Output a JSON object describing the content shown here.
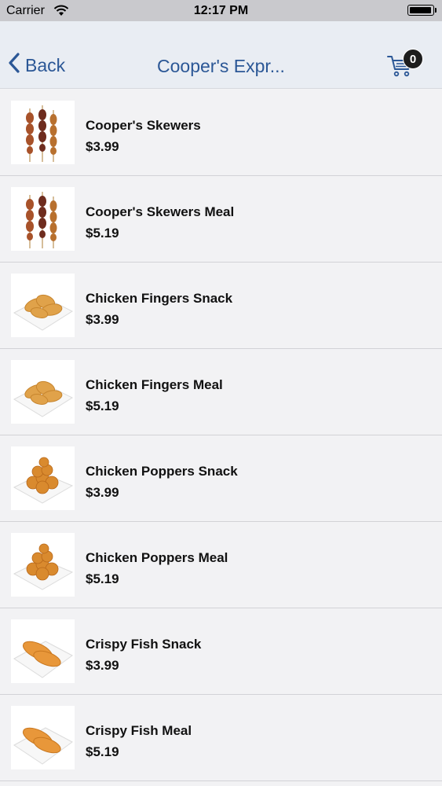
{
  "status_bar": {
    "carrier": "Carrier",
    "time": "12:17 PM"
  },
  "nav": {
    "back_label": "Back",
    "title": "Cooper's Expr...",
    "cart_count": "0"
  },
  "items": [
    {
      "name": "Cooper's Skewers",
      "price": "$3.99",
      "image": "skewers-image"
    },
    {
      "name": "Cooper's Skewers Meal",
      "price": "$5.19",
      "image": "skewers-image"
    },
    {
      "name": "Chicken Fingers Snack",
      "price": "$3.99",
      "image": "chicken-fingers-image"
    },
    {
      "name": "Chicken Fingers Meal",
      "price": "$5.19",
      "image": "chicken-fingers-image"
    },
    {
      "name": "Chicken Poppers Snack",
      "price": "$3.99",
      "image": "chicken-poppers-image"
    },
    {
      "name": "Chicken Poppers Meal",
      "price": "$5.19",
      "image": "chicken-poppers-image"
    },
    {
      "name": "Crispy Fish Snack",
      "price": "$3.99",
      "image": "crispy-fish-image"
    },
    {
      "name": "Crispy Fish Meal",
      "price": "$5.19",
      "image": "crispy-fish-image"
    }
  ],
  "colors": {
    "accent": "#2b5796",
    "nav_background": "#e9edf3",
    "list_background": "#f2f2f4"
  }
}
